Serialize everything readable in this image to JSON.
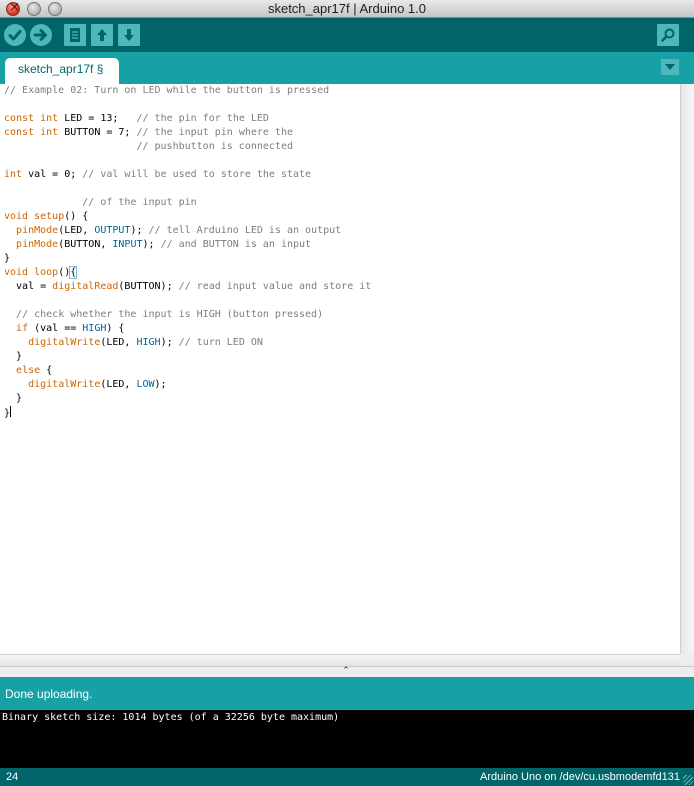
{
  "window": {
    "title": "sketch_apr17f | Arduino 1.0"
  },
  "toolbar": {
    "verify_icon": "checkmark-icon",
    "upload_icon": "arrow-right-icon",
    "new_icon": "document-icon",
    "open_icon": "arrow-up-icon",
    "save_icon": "arrow-down-icon",
    "serial_monitor_icon": "magnifier-icon"
  },
  "tabs": [
    {
      "label": "sketch_apr17f §"
    }
  ],
  "editor": {
    "lines": [
      "// Example 02: Turn on LED while the button is pressed",
      "",
      "const int LED = 13;   // the pin for the LED",
      "const int BUTTON = 7; // the input pin where the",
      "                      // pushbutton is connected",
      "",
      "int val = 0; // val will be used to store the state",
      "",
      "             // of the input pin",
      "void setup() {",
      "  pinMode(LED, OUTPUT); // tell Arduino LED is an output",
      "  pinMode(BUTTON, INPUT); // and BUTTON is an input",
      "}",
      "void loop(){",
      "  val = digitalRead(BUTTON); // read input value and store it",
      "",
      "  // check whether the input is HIGH (button pressed)",
      "  if (val == HIGH) {",
      "    digitalWrite(LED, HIGH); // turn LED ON",
      "  }",
      "  else {",
      "    digitalWrite(LED, LOW);",
      "  }",
      "}"
    ]
  },
  "status": {
    "message": "Done uploading."
  },
  "console": {
    "output": "Binary sketch size: 1014 bytes (of a 32256 byte maximum)"
  },
  "footer": {
    "line_number": "24",
    "board": "Arduino Uno on /dev/cu.usbmodemfd131"
  },
  "colors": {
    "toolbar": "#006468",
    "tabrow": "#17a1a5",
    "keyword": "#cc6600",
    "constant": "#006699",
    "comment": "#7e7e7e"
  }
}
